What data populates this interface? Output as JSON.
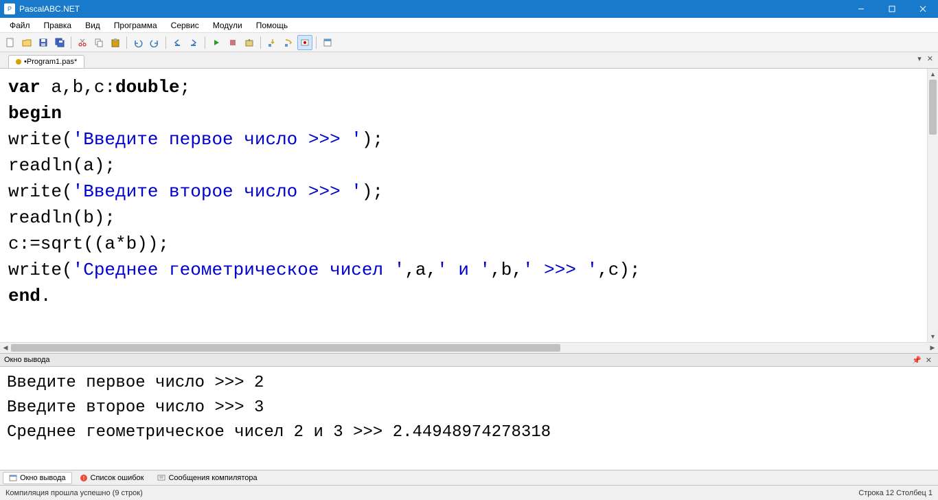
{
  "window": {
    "title": "PascalABC.NET"
  },
  "menu": {
    "items": [
      "Файл",
      "Правка",
      "Вид",
      "Программа",
      "Сервис",
      "Модули",
      "Помощь"
    ]
  },
  "tab": {
    "name": "•Program1.pas*"
  },
  "code": {
    "line1_a": "var",
    "line1_b": " a,b,c:",
    "line1_c": "double",
    "line1_d": ";",
    "line2": "begin",
    "line3_a": "write(",
    "line3_b": "'Введите первое число >>> '",
    "line3_c": ");",
    "line4": "readln(a);",
    "line5_a": "write(",
    "line5_b": "'Введите второе число >>> '",
    "line5_c": ");",
    "line6": "readln(b);",
    "line7": "c:=sqrt((a*b));",
    "line8_a": "write(",
    "line8_b": "'Среднее геометрическое чисел '",
    "line8_c": ",a,",
    "line8_d": "' и '",
    "line8_e": ",b,",
    "line8_f": "' >>> '",
    "line8_g": ",c);",
    "line9_a": "end",
    "line9_b": "."
  },
  "outputPanel": {
    "title": "Окно вывода"
  },
  "output": {
    "line1": "Введите первое число >>> 2",
    "line2": "Введите второе число >>> 3",
    "line3": "Среднее геометрическое чисел 2 и 3 >>> 2.44948974278318"
  },
  "bottomTabs": {
    "t1": "Окно вывода",
    "t2": "Список ошибок",
    "t3": "Сообщения компилятора"
  },
  "status": {
    "left": "Компиляция прошла успешно (9 строк)",
    "right": "Строка  12  Столбец  1"
  }
}
